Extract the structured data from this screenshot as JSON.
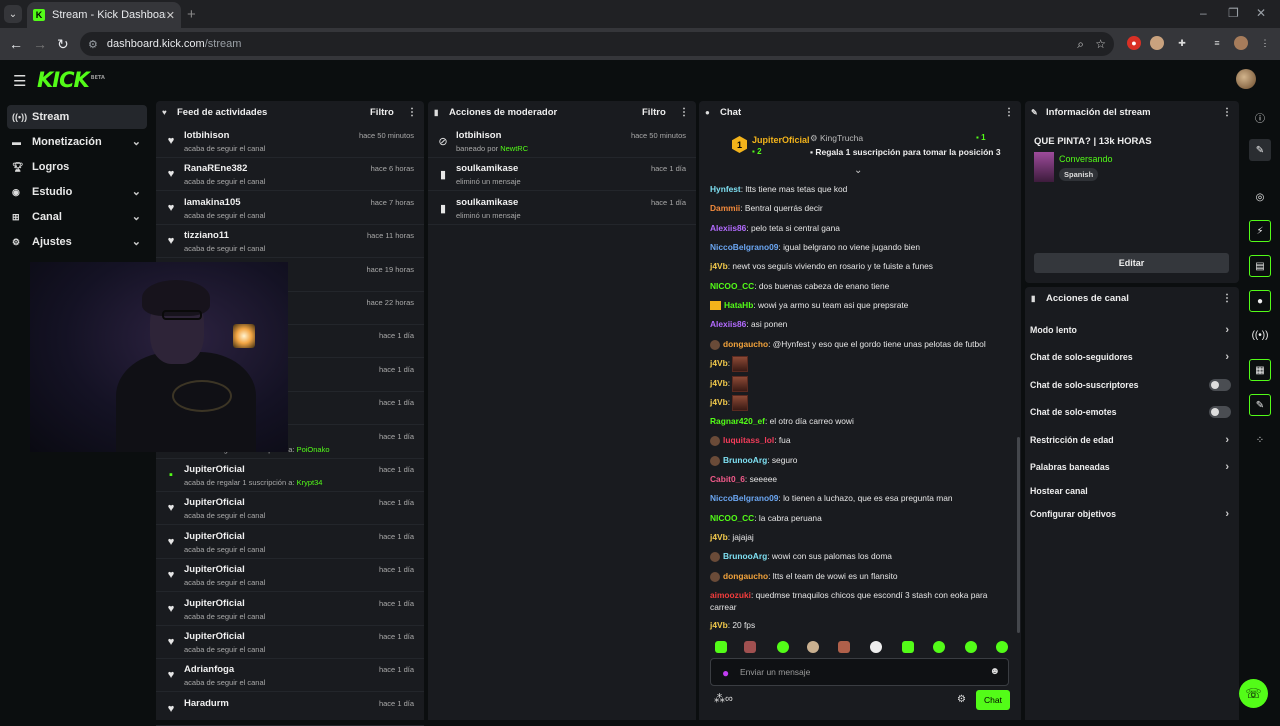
{
  "browser": {
    "tab_title": "Stream - Kick Dashboard",
    "url_host": "dashboard.kick.com",
    "url_path": "/stream"
  },
  "sidebar": {
    "items": [
      {
        "label": "Stream",
        "icon": "broadcast-icon"
      },
      {
        "label": "Monetización",
        "icon": "money-icon"
      },
      {
        "label": "Logros",
        "icon": "trophy-icon"
      },
      {
        "label": "Estudio",
        "icon": "studio-icon"
      },
      {
        "label": "Canal",
        "icon": "channel-icon"
      },
      {
        "label": "Ajustes",
        "icon": "gear-icon"
      }
    ]
  },
  "activity": {
    "title": "Feed de actividades",
    "filter": "Filtro",
    "items": [
      {
        "name": "lotbihison",
        "sub": "acaba de seguir el canal",
        "time": "hace 50 minutos",
        "icon": "heart-icon"
      },
      {
        "name": "RanaREne382",
        "sub": "acaba de seguir el canal",
        "time": "hace 6 horas",
        "icon": "heart-icon"
      },
      {
        "name": "lamakina105",
        "sub": "acaba de seguir el canal",
        "time": "hace 7 horas",
        "icon": "heart-icon"
      },
      {
        "name": "tizziano11",
        "sub": "acaba de seguir el canal",
        "time": "hace 11 horas",
        "icon": "heart-icon"
      },
      {
        "name": "",
        "sub": "",
        "time": "hace 19 horas",
        "icon": "heart-icon"
      },
      {
        "name": "",
        "sub": "",
        "time": "hace 22 horas",
        "icon": "heart-icon"
      },
      {
        "name": "",
        "sub": "",
        "time": "hace 1 día",
        "icon": "heart-icon"
      },
      {
        "name": "",
        "sub": "",
        "time": "hace 1 día",
        "icon": "heart-icon"
      },
      {
        "name": "",
        "sub": "",
        "time": "hace 1 día",
        "icon": "heart-icon"
      },
      {
        "name": "",
        "sub": "acaba de regalar 1 suscripción a:",
        "sub_user": "PoiOnako",
        "time": "hace 1 día",
        "icon": "gift-icon"
      },
      {
        "name": "JupiterOficial",
        "sub": "acaba de regalar 1 suscripción a:",
        "sub_user": "Krypt34",
        "time": "hace 1 día",
        "icon": "gift-icon"
      },
      {
        "name": "JupiterOficial",
        "sub": "acaba de seguir el canal",
        "time": "hace 1 día",
        "icon": "heart-icon"
      },
      {
        "name": "JupiterOficial",
        "sub": "acaba de seguir el canal",
        "time": "hace 1 día",
        "icon": "heart-icon"
      },
      {
        "name": "JupiterOficial",
        "sub": "acaba de seguir el canal",
        "time": "hace 1 día",
        "icon": "heart-icon"
      },
      {
        "name": "JupiterOficial",
        "sub": "acaba de seguir el canal",
        "time": "hace 1 día",
        "icon": "heart-icon"
      },
      {
        "name": "JupiterOficial",
        "sub": "acaba de seguir el canal",
        "time": "hace 1 día",
        "icon": "heart-icon"
      },
      {
        "name": "Adrianfoga",
        "sub": "acaba de seguir el canal",
        "time": "hace 1 día",
        "icon": "heart-icon"
      },
      {
        "name": "Haradurm",
        "sub": "",
        "time": "hace 1 día",
        "icon": "heart-icon"
      }
    ]
  },
  "moderator": {
    "title": "Acciones de moderador",
    "filter": "Filtro",
    "items": [
      {
        "name": "lotbihison",
        "sub": "baneado por",
        "sub_user": "NewtRC",
        "time": "hace 50 minutos",
        "icon": "ban-icon"
      },
      {
        "name": "soulkamikase",
        "sub": "eliminó un mensaje",
        "time": "hace 1 día",
        "icon": "trash-icon"
      },
      {
        "name": "soulkamikase",
        "sub": "eliminó un mensaje",
        "time": "hace 1 día",
        "icon": "trash-icon"
      }
    ]
  },
  "chat": {
    "title": "Chat",
    "pinned": {
      "gifter": "JupiterOficial",
      "gifter_count": "2",
      "user": "KingTrucha",
      "gift_text": "Regala 1 suscripción para tomar la posición 3",
      "count": "1"
    },
    "messages": [
      {
        "user": "Hynfest",
        "color": "#7ee0f2",
        "text": ": ltts tiene mas tetas que kod"
      },
      {
        "user": "Dammii",
        "color": "#f28a3c",
        "text": ": Bentral querrás decir"
      },
      {
        "user": "Alexiis86",
        "color": "#b36bff",
        "text": ": pelo teta si central gana"
      },
      {
        "user": "NiccoBelgrano09",
        "color": "#6ba6f2",
        "text": ": igual belgrano no viene jugando bien"
      },
      {
        "user": "j4Vb",
        "color": "#f2c94c",
        "text": ": newt vos seguís viviendo en rosario y te fuiste a funes"
      },
      {
        "user": "NICOO_CC",
        "color": "#53fc18",
        "text": ": dos buenas cabeza de enano tiene"
      },
      {
        "user": "HataHb",
        "color": "#53fc18",
        "text": ": wowi ya armo su team asi que prepsrate"
      },
      {
        "user": "Alexiis86",
        "color": "#b36bff",
        "text": ": asi ponen"
      },
      {
        "user": "dongaucho",
        "color": "#f2a33c",
        "text": ": @Hynfest y eso que el gordo tiene unas pelotas de futbol"
      },
      {
        "user": "j4Vb",
        "color": "#f2c94c",
        "text": ":"
      },
      {
        "user": "j4Vb",
        "color": "#f2c94c",
        "text": ":"
      },
      {
        "user": "j4Vb",
        "color": "#f2c94c",
        "text": ":"
      },
      {
        "user": "Ragnar420_ef",
        "color": "#53fc18",
        "text": ": el otro día carreo wowi"
      },
      {
        "user": "luquitass_lol",
        "color": "#f23c5a",
        "text": ": fua"
      },
      {
        "user": "BrunooArg",
        "color": "#7ee0f2",
        "text": ": seguro"
      },
      {
        "user": "Cabit0_6",
        "color": "#f25a8a",
        "text": ": seeeee"
      },
      {
        "user": "NiccoBelgrano09",
        "color": "#6ba6f2",
        "text": ": lo tienen a luchazo, que es esa pregunta man"
      },
      {
        "user": "NICOO_CC",
        "color": "#53fc18",
        "text": ": la cabra peruana"
      },
      {
        "user": "j4Vb",
        "color": "#f2c94c",
        "text": ": jajajaj"
      },
      {
        "user": "BrunooArg",
        "color": "#7ee0f2",
        "text": ": wowi con sus palomas los doma"
      },
      {
        "user": "dongaucho",
        "color": "#f2a33c",
        "text": ": ltts el team de wowi es un flansito"
      },
      {
        "user": "aimoozuki",
        "color": "#f23c3c",
        "text": ": quedmse trnaquilos chicos que escondí 3 stash con eoka para carrear"
      },
      {
        "user": "j4Vb",
        "color": "#f2c94c",
        "text": ": 20 fps"
      }
    ],
    "input_placeholder": "Enviar un mensaje",
    "send_label": "Chat",
    "infinity": "∞"
  },
  "stream_info": {
    "title": "Información del stream",
    "stream_title": "QUE PINTA? | 13k HORAS",
    "category": "Conversando",
    "language": "Spanish",
    "edit_label": "Editar"
  },
  "channel_actions": {
    "title": "Acciones de canal",
    "items": [
      {
        "label": "Modo lento",
        "control": "chevron"
      },
      {
        "label": "Chat de solo-seguidores",
        "control": "chevron"
      },
      {
        "label": "Chat de solo-suscriptores",
        "control": "toggle"
      },
      {
        "label": "Chat de solo-emotes",
        "control": "toggle"
      },
      {
        "label": "Restricción de edad",
        "control": "chevron"
      },
      {
        "label": "Palabras baneadas",
        "control": "chevron"
      },
      {
        "label": "Hostear canal",
        "control": "none"
      },
      {
        "label": "Configurar objetivos",
        "control": "chevron"
      }
    ]
  },
  "colors": {
    "accent": "#53fc18",
    "panel": "#191b1f",
    "background": "#0b0e0f"
  }
}
